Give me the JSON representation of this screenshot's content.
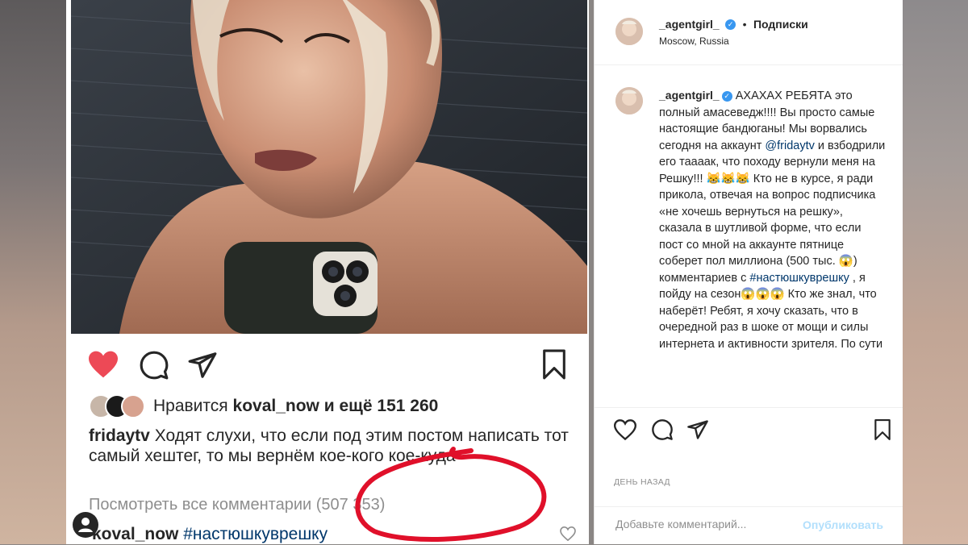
{
  "left_post": {
    "likes": {
      "prefix": "Нравится",
      "user": "koval_now",
      "suffix": "и ещё 151 260"
    },
    "caption": {
      "user": "fridaytv",
      "text": "Ходят слухи, что если под этим постом написать тот самый хештег, то мы вернём кое-кого кое-куда"
    },
    "view_comments": "Посмотреть все комментарии (507 353)",
    "comment": {
      "user": "koval_now",
      "text": "#настюшкуврешку"
    },
    "icons": {
      "like": "heart-filled-icon",
      "comment": "comment-icon",
      "share": "send-icon",
      "save": "bookmark-icon"
    },
    "colors": {
      "like_red": "#ed4956",
      "highlight_circle": "#e0102a"
    }
  },
  "right_panel": {
    "header": {
      "username": "_agentgirl_",
      "separator": "•",
      "follow": "Подписки",
      "location": "Moscow, Russia"
    },
    "post": {
      "username": "_agentgirl_",
      "part1": "АХАХАХ РЕБЯТА это полный амасеведж!!!! Вы просто самые настоящие бандюганы! Мы ворвались сегодня на аккаунт ",
      "mention": "@fridaytv",
      "part2": " и взбодрили его таааак, что походу вернули меня на Решку!!! 😹😹😹 Кто не в курсе, я ради прикола, отвечая на вопрос подписчика «не хочешь вернуться на решку», сказала в шутливой форме, что если пост со мной на аккаунте пятнице соберет пол миллиона (500 тыс. 😱) комментариев с ",
      "hashtag": "#настюшкуврешку",
      "part3": " , я пойду на сезон😱😱😱 Кто же знал, что наберёт! Ребят, я хочу сказать, что в очередной раз в шоке от мощи и силы интернета и активности зрителя. По сути"
    },
    "time": "ДЕНЬ НАЗАД",
    "add_comment_placeholder": "Добавьте комментарий...",
    "publish": "Опубликовать"
  }
}
